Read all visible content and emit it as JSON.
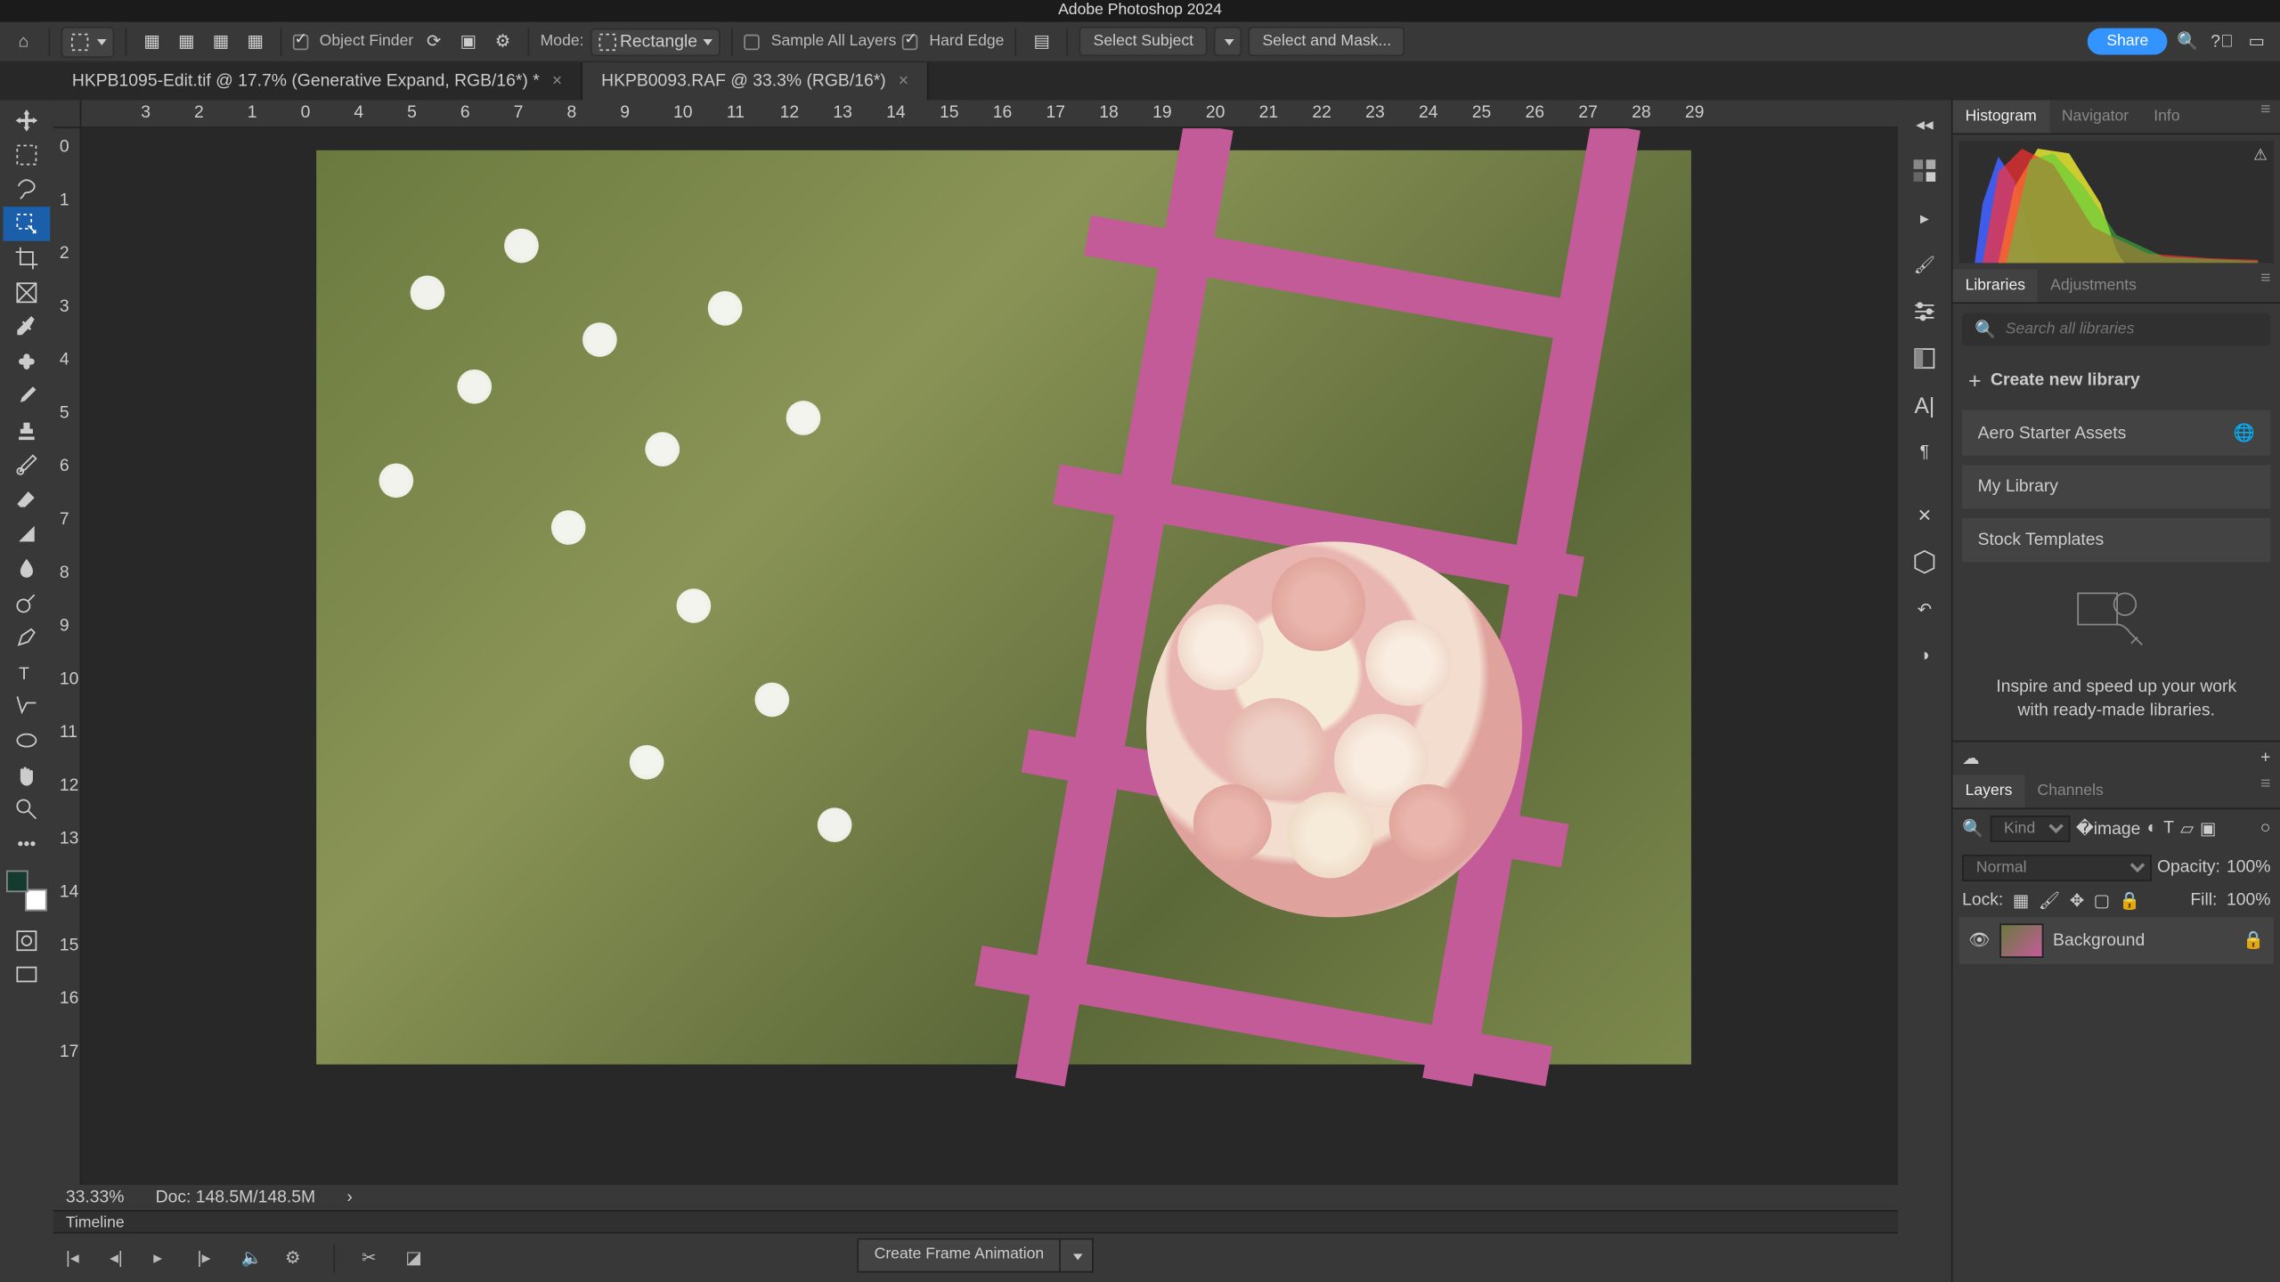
{
  "app_title": "Adobe Photoshop 2024",
  "options": {
    "object_finder": "Object Finder",
    "mode_label": "Mode:",
    "mode_value": "Rectangle",
    "sample_all": "Sample All Layers",
    "hard_edge": "Hard Edge",
    "select_subject": "Select Subject",
    "select_mask": "Select and Mask...",
    "share": "Share"
  },
  "tabs": [
    {
      "label": "HKPB1095-Edit.tif @ 17.7% (Generative Expand, RGB/16*) *"
    },
    {
      "label": "HKPB0093.RAF @ 33.3% (RGB/16*)"
    }
  ],
  "ruler_h": [
    "4",
    "5",
    "6",
    "7",
    "8",
    "9",
    "10",
    "11",
    "12",
    "13",
    "14",
    "15",
    "16",
    "17",
    "18",
    "19",
    "20",
    "21",
    "22",
    "23",
    "24",
    "25",
    "26",
    "27",
    "28",
    "29"
  ],
  "ruler_marks": [
    "0",
    "1",
    "2",
    "3"
  ],
  "ruler_v": [
    "0",
    "1",
    "2",
    "3",
    "4",
    "5",
    "6",
    "7",
    "8",
    "9",
    "10",
    "11",
    "12",
    "13",
    "14",
    "15",
    "16",
    "17"
  ],
  "status": {
    "zoom": "33.33%",
    "doc": "Doc: 148.5M/148.5M"
  },
  "timeline": {
    "label": "Timeline",
    "create": "Create Frame Animation"
  },
  "panel_tabs_top": [
    "Histogram",
    "Navigator",
    "Info"
  ],
  "panel_tabs_lib": [
    "Libraries",
    "Adjustments"
  ],
  "libraries": {
    "search_ph": "Search all libraries",
    "create": "Create new library",
    "items": [
      "Aero Starter Assets",
      "My Library",
      "Stock Templates"
    ],
    "empty1": "Inspire and speed up your work",
    "empty2": "with ready-made libraries."
  },
  "panel_tabs_lay": [
    "Layers",
    "Channels"
  ],
  "layers": {
    "kind": "Kind",
    "blend": "Normal",
    "opacity_l": "Opacity:",
    "opacity_v": "100%",
    "lock_l": "Lock:",
    "fill_l": "Fill:",
    "fill_v": "100%",
    "bg": "Background"
  }
}
